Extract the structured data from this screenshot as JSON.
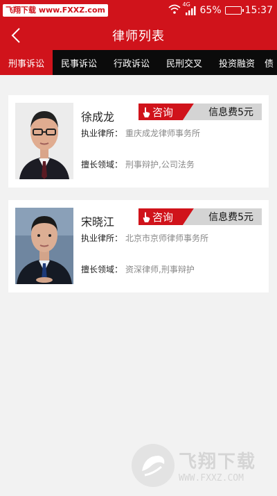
{
  "status_bar": {
    "watermark": "飞翔下载 www.FXXZ.com",
    "network": "4G",
    "battery_pct": "65%",
    "battery_level": 0.65,
    "time": "15:37"
  },
  "header": {
    "title": "律师列表"
  },
  "tabs": [
    {
      "label": "刑事诉讼",
      "active": true
    },
    {
      "label": "民事诉讼",
      "active": false
    },
    {
      "label": "行政诉讼",
      "active": false
    },
    {
      "label": "民刑交叉",
      "active": false
    },
    {
      "label": "投资融资",
      "active": false
    },
    {
      "label": "债",
      "active": false
    }
  ],
  "lawyers": [
    {
      "name": "徐成龙",
      "consult_label": "咨询",
      "fee": "信息费5元",
      "firm_label": "执业律所：",
      "firm": "重庆成龙律师事务所",
      "expertise_label": "擅长领域：",
      "expertise": "刑事辩护,公司法务"
    },
    {
      "name": "宋晓江",
      "consult_label": "咨询",
      "fee": "信息费5元",
      "firm_label": "执业律所：",
      "firm": "北京市京师律师事务所",
      "expertise_label": "擅长领域：",
      "expertise": "资深律师,刑事辩护"
    }
  ],
  "watermark_bottom": {
    "brand": "飞翔下载",
    "url": "WWW.FXXZ.COM"
  },
  "colors": {
    "primary_red": "#d0131b",
    "tab_bar": "#0b0b0b",
    "fee_gray": "#d4d4d4"
  }
}
